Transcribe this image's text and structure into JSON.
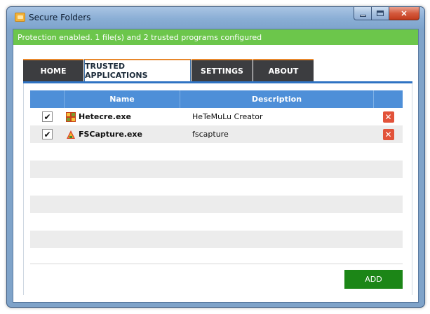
{
  "window": {
    "title": "Secure Folders",
    "controls": {
      "minimize": "",
      "maximize": "",
      "close": "✕"
    }
  },
  "status": {
    "text": "Protection enabled. 1 file(s) and 2 trusted programs configured",
    "color": "#6cc64b"
  },
  "tabs": [
    {
      "label": "HOME",
      "active": false
    },
    {
      "label": "TRUSTED APPLICATIONS",
      "active": true
    },
    {
      "label": "SETTINGS",
      "active": false
    },
    {
      "label": "ABOUT",
      "active": false
    }
  ],
  "table": {
    "columns": [
      "",
      "Name",
      "Description",
      ""
    ],
    "rows": [
      {
        "checked": true,
        "check_glyph": "✔",
        "name": "Hetecre.exe",
        "icon": "hetecre-app-icon",
        "description": "HeTeMuLu Creator",
        "delete_glyph": "✕"
      },
      {
        "checked": true,
        "check_glyph": "✔",
        "name": "FSCapture.exe",
        "icon": "fscapture-app-icon",
        "description": "fscapture",
        "delete_glyph": "✕"
      }
    ]
  },
  "actions": {
    "add_label": "ADD"
  },
  "colors": {
    "accent_tab_border": "#e8872b",
    "header_blue": "#4e8fd8",
    "add_button": "#1c8617",
    "delete_button": "#e2533a"
  }
}
